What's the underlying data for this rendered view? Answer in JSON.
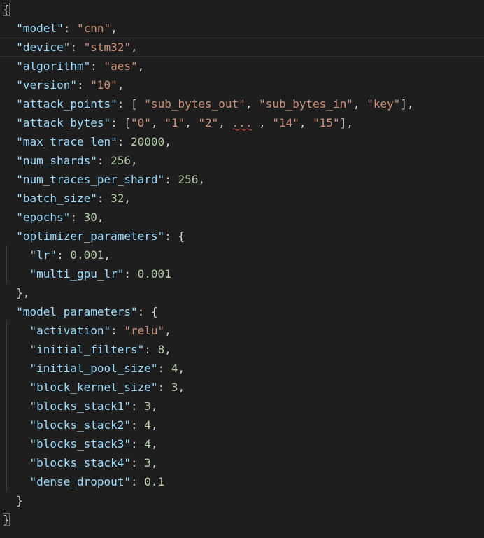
{
  "editor": {
    "lines": [
      [
        {
          "t": "p",
          "v": "{"
        }
      ],
      [
        {
          "t": "p",
          "v": "  "
        },
        {
          "t": "k",
          "v": "\"model\""
        },
        {
          "t": "p",
          "v": ": "
        },
        {
          "t": "s",
          "v": "\"cnn\""
        },
        {
          "t": "p",
          "v": ","
        }
      ],
      [
        {
          "t": "p",
          "v": "  "
        },
        {
          "t": "k",
          "v": "\"device\""
        },
        {
          "t": "p",
          "v": ": "
        },
        {
          "t": "s",
          "v": "\"stm32\""
        },
        {
          "t": "p",
          "v": ","
        }
      ],
      [
        {
          "t": "p",
          "v": "  "
        },
        {
          "t": "k",
          "v": "\"algorithm\""
        },
        {
          "t": "p",
          "v": ": "
        },
        {
          "t": "s",
          "v": "\"aes\""
        },
        {
          "t": "p",
          "v": ","
        }
      ],
      [
        {
          "t": "p",
          "v": "  "
        },
        {
          "t": "k",
          "v": "\"version\""
        },
        {
          "t": "p",
          "v": ": "
        },
        {
          "t": "s",
          "v": "\"10\""
        },
        {
          "t": "p",
          "v": ","
        }
      ],
      [
        {
          "t": "p",
          "v": "  "
        },
        {
          "t": "k",
          "v": "\"attack_points\""
        },
        {
          "t": "p",
          "v": ": [ "
        },
        {
          "t": "s",
          "v": "\"sub_bytes_out\""
        },
        {
          "t": "p",
          "v": ", "
        },
        {
          "t": "s",
          "v": "\"sub_bytes_in\""
        },
        {
          "t": "p",
          "v": ", "
        },
        {
          "t": "s",
          "v": "\"key\""
        },
        {
          "t": "p",
          "v": "],"
        }
      ],
      [
        {
          "t": "p",
          "v": "  "
        },
        {
          "t": "k",
          "v": "\"attack_bytes\""
        },
        {
          "t": "p",
          "v": ": ["
        },
        {
          "t": "s",
          "v": "\"0\""
        },
        {
          "t": "p",
          "v": ", "
        },
        {
          "t": "s",
          "v": "\"1\""
        },
        {
          "t": "p",
          "v": ", "
        },
        {
          "t": "s",
          "v": "\"2\""
        },
        {
          "t": "p",
          "v": ", "
        },
        {
          "t": "squig",
          "v": "...",
          "error": true
        },
        {
          "t": "p",
          "v": " , "
        },
        {
          "t": "s",
          "v": "\"14\""
        },
        {
          "t": "p",
          "v": ", "
        },
        {
          "t": "s",
          "v": "\"15\""
        },
        {
          "t": "p",
          "v": "],"
        }
      ],
      [
        {
          "t": "p",
          "v": "  "
        },
        {
          "t": "k",
          "v": "\"max_trace_len\""
        },
        {
          "t": "p",
          "v": ": "
        },
        {
          "t": "n",
          "v": "20000"
        },
        {
          "t": "p",
          "v": ","
        }
      ],
      [
        {
          "t": "p",
          "v": "  "
        },
        {
          "t": "k",
          "v": "\"num_shards\""
        },
        {
          "t": "p",
          "v": ": "
        },
        {
          "t": "n",
          "v": "256"
        },
        {
          "t": "p",
          "v": ","
        }
      ],
      [
        {
          "t": "p",
          "v": "  "
        },
        {
          "t": "k",
          "v": "\"num_traces_per_shard\""
        },
        {
          "t": "p",
          "v": ": "
        },
        {
          "t": "n",
          "v": "256"
        },
        {
          "t": "p",
          "v": ","
        }
      ],
      [
        {
          "t": "p",
          "v": "  "
        },
        {
          "t": "k",
          "v": "\"batch_size\""
        },
        {
          "t": "p",
          "v": ": "
        },
        {
          "t": "n",
          "v": "32"
        },
        {
          "t": "p",
          "v": ","
        }
      ],
      [
        {
          "t": "p",
          "v": "  "
        },
        {
          "t": "k",
          "v": "\"epochs\""
        },
        {
          "t": "p",
          "v": ": "
        },
        {
          "t": "n",
          "v": "30"
        },
        {
          "t": "p",
          "v": ","
        }
      ],
      [
        {
          "t": "p",
          "v": "  "
        },
        {
          "t": "k",
          "v": "\"optimizer_parameters\""
        },
        {
          "t": "p",
          "v": ": {"
        }
      ],
      [
        {
          "t": "p",
          "v": "    "
        },
        {
          "t": "k",
          "v": "\"lr\""
        },
        {
          "t": "p",
          "v": ": "
        },
        {
          "t": "n",
          "v": "0.001"
        },
        {
          "t": "p",
          "v": ","
        }
      ],
      [
        {
          "t": "p",
          "v": "    "
        },
        {
          "t": "k",
          "v": "\"multi_gpu_lr\""
        },
        {
          "t": "p",
          "v": ": "
        },
        {
          "t": "n",
          "v": "0.001"
        }
      ],
      [
        {
          "t": "p",
          "v": "  },"
        }
      ],
      [
        {
          "t": "p",
          "v": "  "
        },
        {
          "t": "k",
          "v": "\"model_parameters\""
        },
        {
          "t": "p",
          "v": ": {"
        }
      ],
      [
        {
          "t": "p",
          "v": "    "
        },
        {
          "t": "k",
          "v": "\"activation\""
        },
        {
          "t": "p",
          "v": ": "
        },
        {
          "t": "s",
          "v": "\"relu\""
        },
        {
          "t": "p",
          "v": ","
        }
      ],
      [
        {
          "t": "p",
          "v": "    "
        },
        {
          "t": "k",
          "v": "\"initial_filters\""
        },
        {
          "t": "p",
          "v": ": "
        },
        {
          "t": "n",
          "v": "8"
        },
        {
          "t": "p",
          "v": ","
        }
      ],
      [
        {
          "t": "p",
          "v": "    "
        },
        {
          "t": "k",
          "v": "\"initial_pool_size\""
        },
        {
          "t": "p",
          "v": ": "
        },
        {
          "t": "n",
          "v": "4"
        },
        {
          "t": "p",
          "v": ","
        }
      ],
      [
        {
          "t": "p",
          "v": "    "
        },
        {
          "t": "k",
          "v": "\"block_kernel_size\""
        },
        {
          "t": "p",
          "v": ": "
        },
        {
          "t": "n",
          "v": "3"
        },
        {
          "t": "p",
          "v": ","
        }
      ],
      [
        {
          "t": "p",
          "v": "    "
        },
        {
          "t": "k",
          "v": "\"blocks_stack1\""
        },
        {
          "t": "p",
          "v": ": "
        },
        {
          "t": "n",
          "v": "3"
        },
        {
          "t": "p",
          "v": ","
        }
      ],
      [
        {
          "t": "p",
          "v": "    "
        },
        {
          "t": "k",
          "v": "\"blocks_stack2\""
        },
        {
          "t": "p",
          "v": ": "
        },
        {
          "t": "n",
          "v": "4"
        },
        {
          "t": "p",
          "v": ","
        }
      ],
      [
        {
          "t": "p",
          "v": "    "
        },
        {
          "t": "k",
          "v": "\"blocks_stack3\""
        },
        {
          "t": "p",
          "v": ": "
        },
        {
          "t": "n",
          "v": "4"
        },
        {
          "t": "p",
          "v": ","
        }
      ],
      [
        {
          "t": "p",
          "v": "    "
        },
        {
          "t": "k",
          "v": "\"blocks_stack4\""
        },
        {
          "t": "p",
          "v": ": "
        },
        {
          "t": "n",
          "v": "3"
        },
        {
          "t": "p",
          "v": ","
        }
      ],
      [
        {
          "t": "p",
          "v": "    "
        },
        {
          "t": "k",
          "v": "\"dense_dropout\""
        },
        {
          "t": "p",
          "v": ": "
        },
        {
          "t": "n",
          "v": "0.1"
        }
      ],
      [
        {
          "t": "p",
          "v": "  }"
        }
      ],
      [
        {
          "t": "p",
          "v": "}"
        }
      ]
    ]
  },
  "colors": {
    "background": "#1e1e1e",
    "key": "#9cdcfe",
    "string": "#ce9178",
    "number": "#b5cea8",
    "punctuation": "#d4d4d4",
    "error_squiggle": "#f14c4c"
  }
}
